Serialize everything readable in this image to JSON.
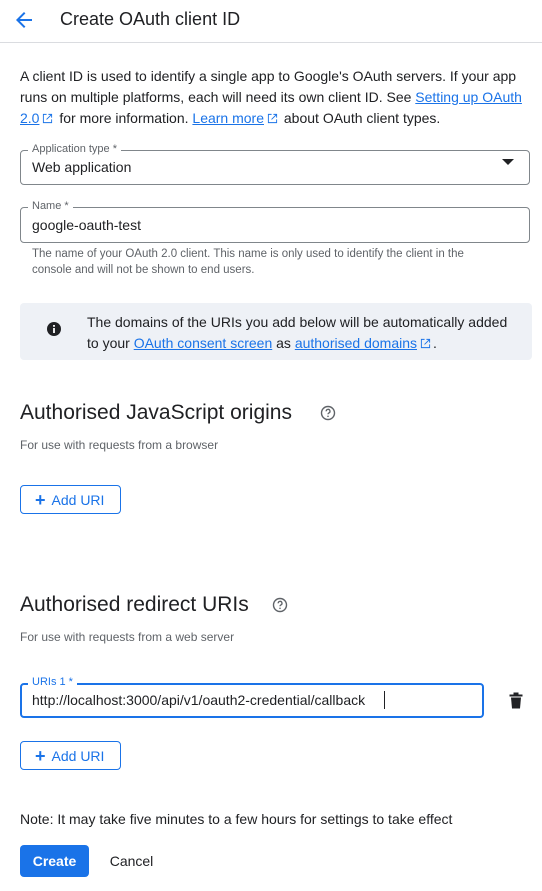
{
  "header": {
    "title": "Create OAuth client ID",
    "back_icon": "arrow-back-icon"
  },
  "intro": {
    "text1": "A client ID is used to identify a single app to Google's OAuth servers. If your app runs on multiple platforms, each will need its own client ID. See ",
    "link1": "Setting up OAuth 2.0",
    "text2": " for more information. ",
    "link2": "Learn more",
    "text3": " about OAuth client types."
  },
  "app_type": {
    "label": "Application type *",
    "value": "Web application"
  },
  "name_field": {
    "label": "Name *",
    "value": "google-oauth-test",
    "helper": "The name of your OAuth 2.0 client. This name is only used to identify the client in the console and will not be shown to end users."
  },
  "banner": {
    "text1": "The domains of the URIs you add below will be automatically added to your ",
    "link1": "OAuth consent screen",
    "text2": " as ",
    "link2": "authorised domains",
    "text3": "."
  },
  "js_origins": {
    "title": "Authorised JavaScript origins",
    "subtitle": "For use with requests from a browser",
    "add_label": "Add URI"
  },
  "redirect_uris": {
    "title": "Authorised redirect URIs",
    "subtitle": "For use with requests from a web server",
    "uri_label": "URIs 1 *",
    "uri_value": "http://localhost:3000/api/v1/oauth2-credential/callback",
    "add_label": "Add URI"
  },
  "note": "Note: It may take five minutes to a few hours for settings to take effect",
  "actions": {
    "create": "Create",
    "cancel": "Cancel"
  },
  "colors": {
    "accent": "#1a73e8",
    "banner_bg": "#eef1f6",
    "text": "#202124",
    "muted": "#5f6368"
  }
}
